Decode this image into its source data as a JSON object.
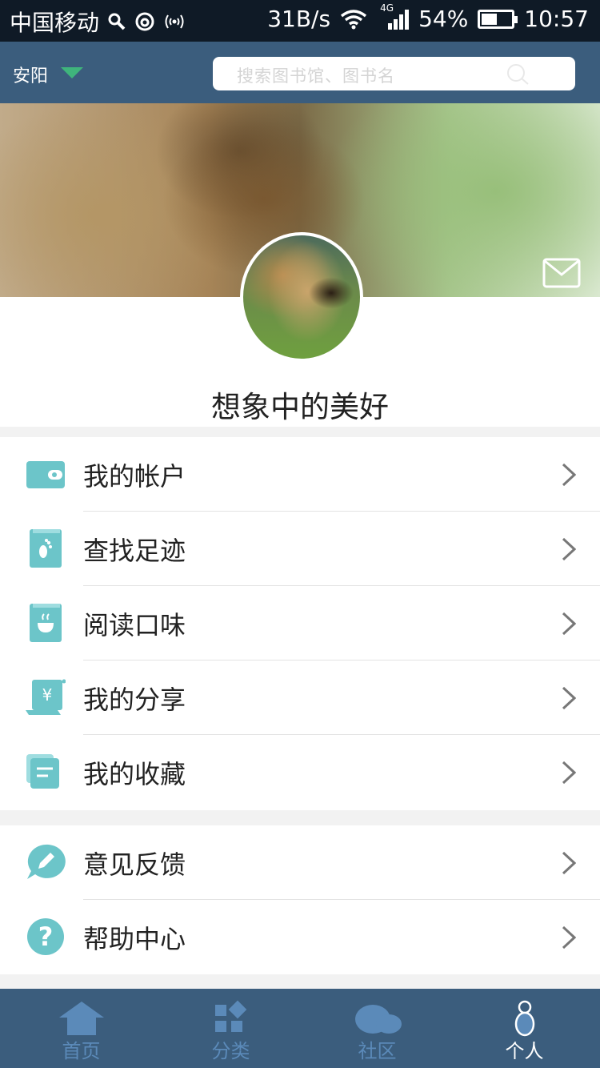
{
  "status_bar": {
    "carrier": "中国移动",
    "speed": "31B/s",
    "network": "4G",
    "battery": "54%",
    "battery_level": 0.54,
    "time": "10:57"
  },
  "header": {
    "city": "安阳",
    "search_placeholder": "搜索图书馆、图书名"
  },
  "profile": {
    "nickname": "想象中的美好"
  },
  "menu_group_1": [
    {
      "label": "我的帐户",
      "icon": "wallet-icon"
    },
    {
      "label": "查找足迹",
      "icon": "footprint-book-icon"
    },
    {
      "label": "阅读口味",
      "icon": "cup-book-icon"
    },
    {
      "label": "我的分享",
      "icon": "yen-scroll-icon"
    },
    {
      "label": "我的收藏",
      "icon": "stacked-notes-icon"
    }
  ],
  "menu_group_2": [
    {
      "label": "意见反馈",
      "icon": "pencil-bubble-icon"
    },
    {
      "label": "帮助中心",
      "icon": "question-circle-icon"
    }
  ],
  "tabs": [
    {
      "label": "首页",
      "icon": "home-icon",
      "active": false
    },
    {
      "label": "分类",
      "icon": "category-icon",
      "active": false
    },
    {
      "label": "社区",
      "icon": "cloud-icon",
      "active": false
    },
    {
      "label": "个人",
      "icon": "person-icon",
      "active": true
    }
  ],
  "colors": {
    "header": "#3b5d7d",
    "accent": "#6cc5c9",
    "tab_inactive": "#5b8ab9",
    "city_arrow": "#3fb47c"
  }
}
